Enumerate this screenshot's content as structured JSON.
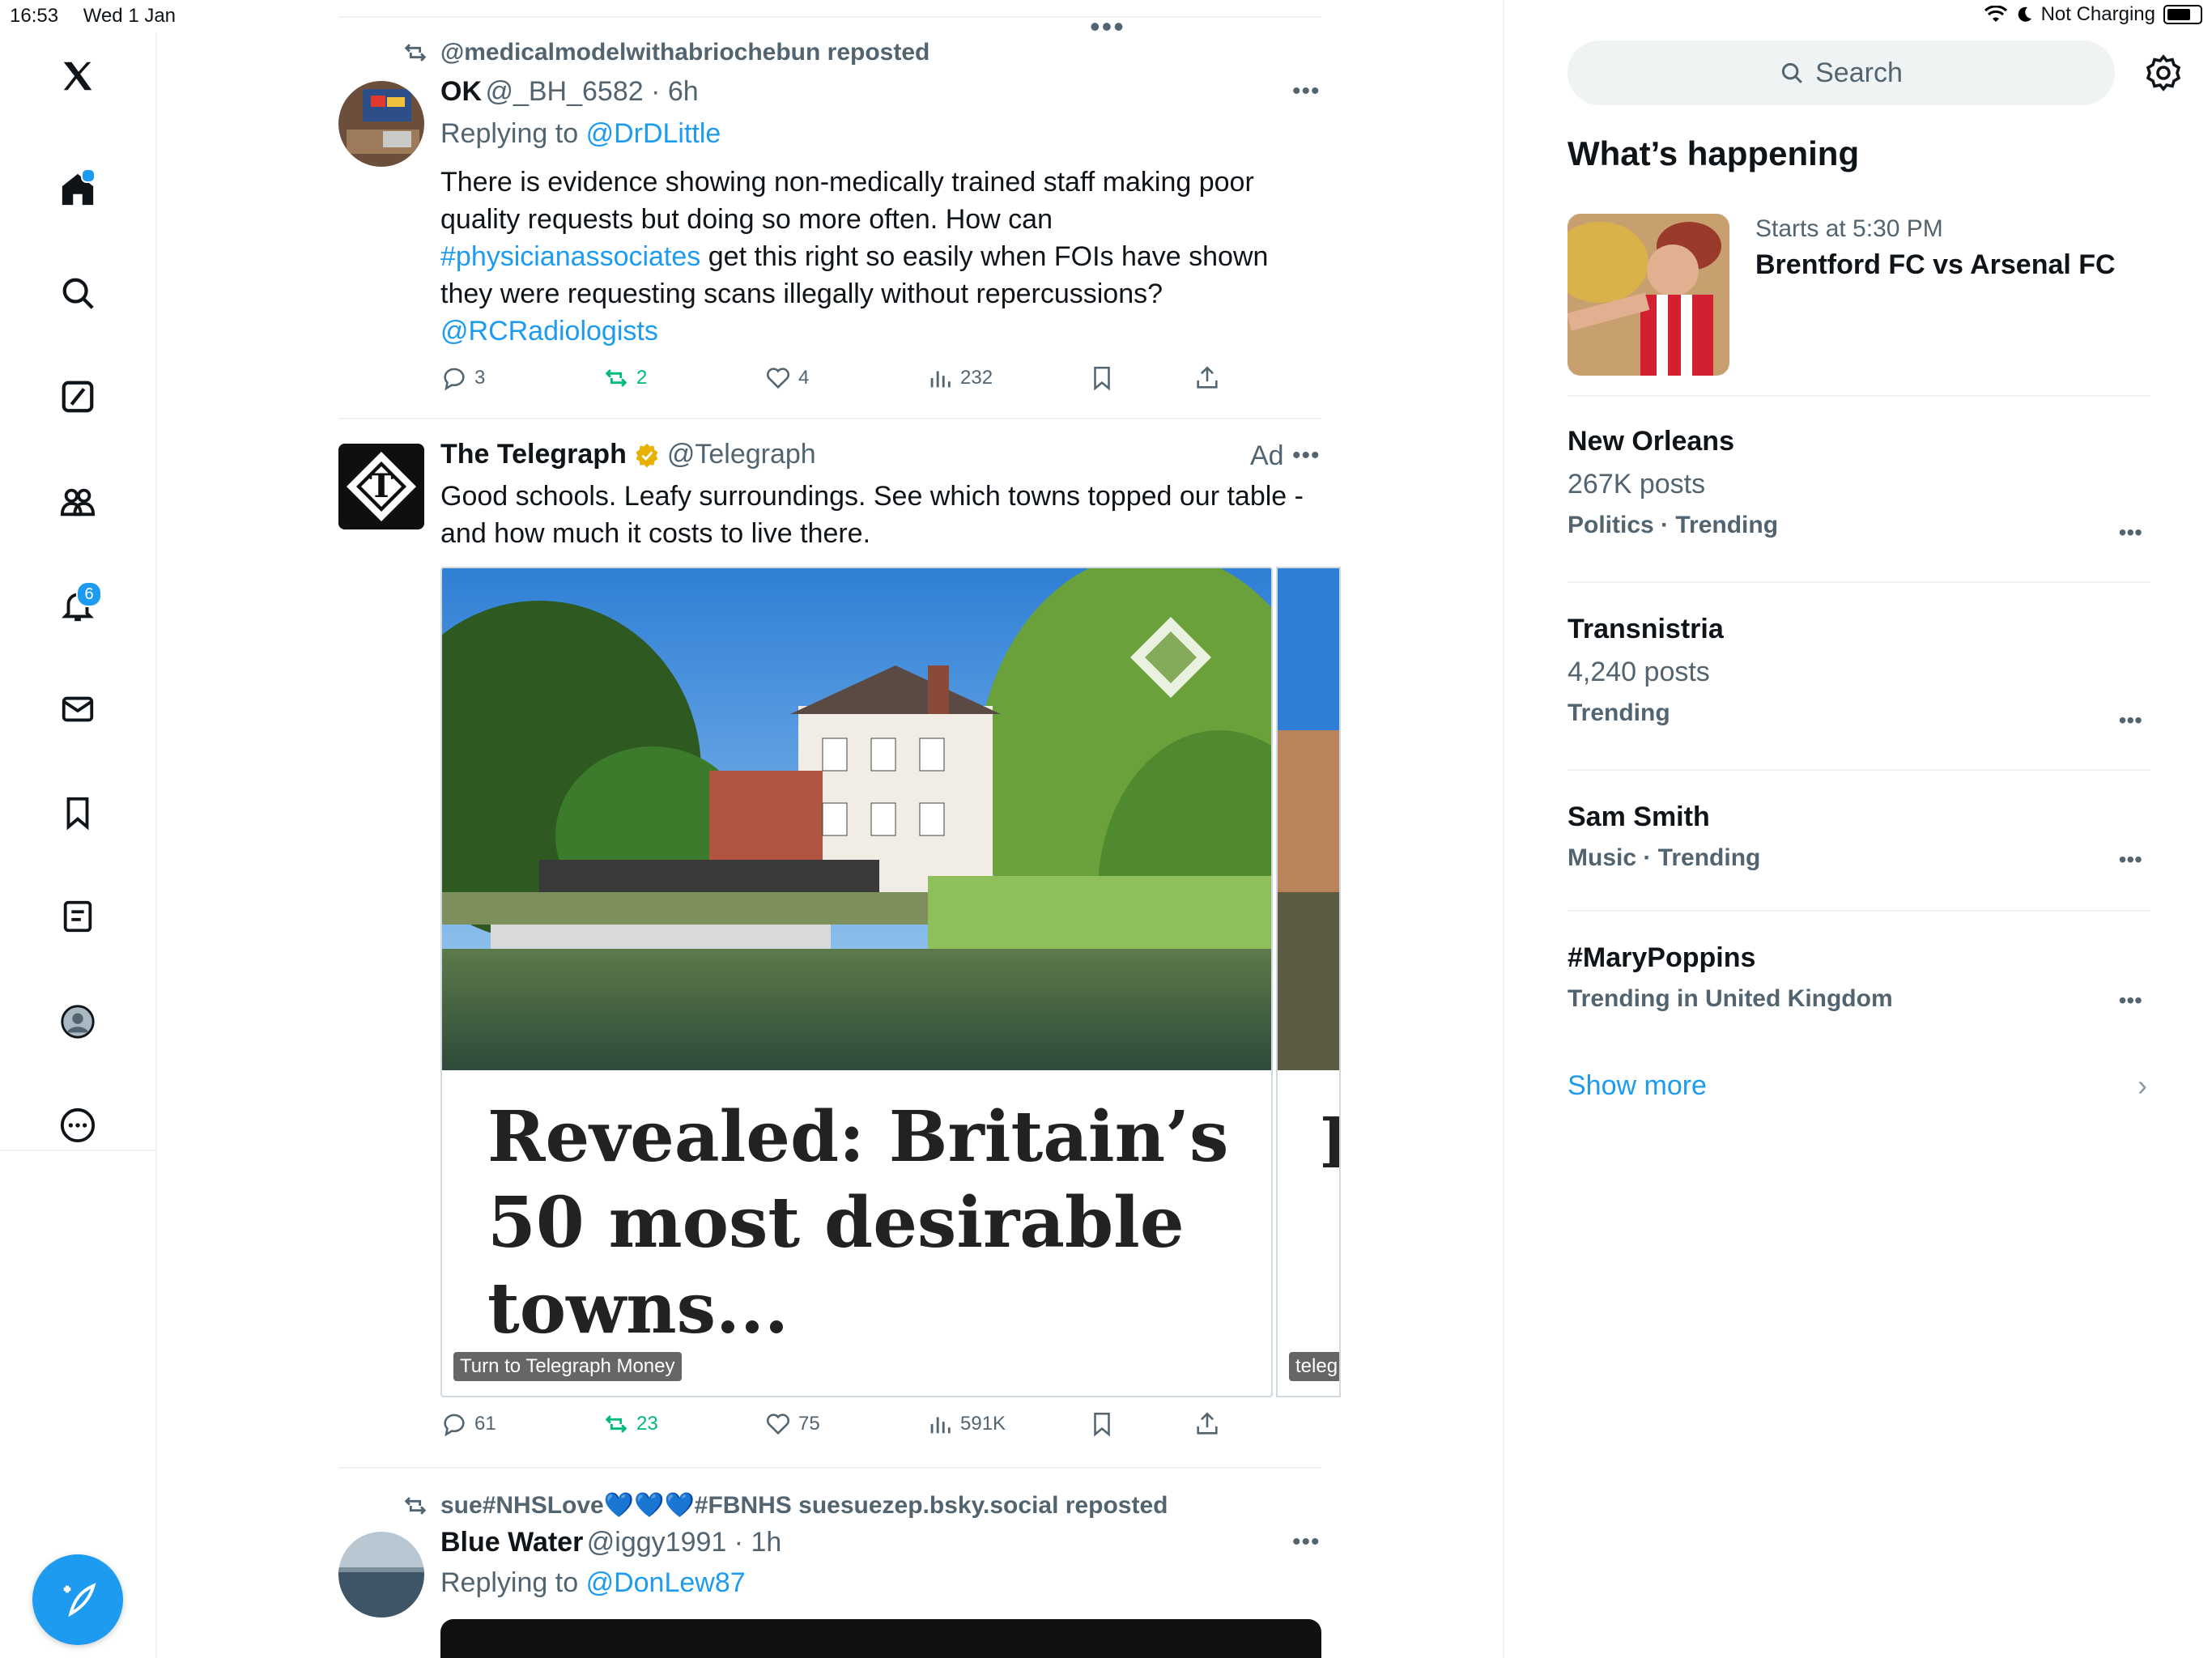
{
  "status_bar": {
    "time": "16:53",
    "date": "Wed 1 Jan",
    "charging": "Not Charging"
  },
  "nav": {
    "notifications_badge": "6"
  },
  "timeline": {
    "top_dots": "•••",
    "tweets": [
      {
        "repost_by": "@medicalmodelwithabriochebun reposted",
        "name": "OK",
        "handle_time": "@_BH_6582 · 6h",
        "replying_prefix": "Replying to",
        "replying_to": "@DrDLittle",
        "text_part1": "There is evidence showing non-medically trained staff making poor quality requests but doing so more often. How can",
        "hashtag": "#physicianassociates",
        "text_part2": "get this right so easily when FOIs have shown they were requesting scans illegally without repercussions?",
        "mention": "@RCRadiologists",
        "replies": "3",
        "reposts": "2",
        "likes": "4",
        "views": "232",
        "more": "•••"
      },
      {
        "name": "The Telegraph",
        "handle": "@Telegraph",
        "ad_label": "Ad",
        "text": "Good schools. Leafy surroundings. See which towns topped our table - and how much it costs to live there.",
        "card_headline": "Revealed: Britain’s 50 most desirable towns...",
        "card_tag": "Turn to Telegraph Money",
        "card2_tag": "teleg",
        "card2_headline_partial": "I",
        "replies": "61",
        "reposts": "23",
        "likes": "75",
        "views": "591K",
        "more": "•••"
      },
      {
        "repost_by": "sue#NHSLove💙💙💙#FBNHS suesuezep.bsky.social reposted",
        "name": "Blue Water",
        "handle_time": "@iggy1991 · 1h",
        "replying_prefix": "Replying to",
        "replying_to": "@DonLew87",
        "more": "•••"
      }
    ]
  },
  "sidebar": {
    "search_placeholder": "Search",
    "section_title": "What’s happening",
    "event": {
      "time": "Starts at 5:30 PM",
      "title": "Brentford FC vs Arsenal FC"
    },
    "trends": [
      {
        "name": "New Orleans",
        "posts": "267K posts",
        "category": "Politics · Trending"
      },
      {
        "name": "Transnistria",
        "posts": "4,240 posts",
        "category": "Trending"
      },
      {
        "name": "Sam Smith",
        "category": "Music · Trending"
      },
      {
        "name": "#MaryPoppins",
        "category": "Trending in United Kingdom"
      }
    ],
    "trend_more": "•••",
    "show_more": "Show more",
    "chevron": "›"
  },
  "colors": {
    "accent": "#1d9bf0",
    "repost_green": "#00ba7c",
    "verified": "#e8b100"
  }
}
